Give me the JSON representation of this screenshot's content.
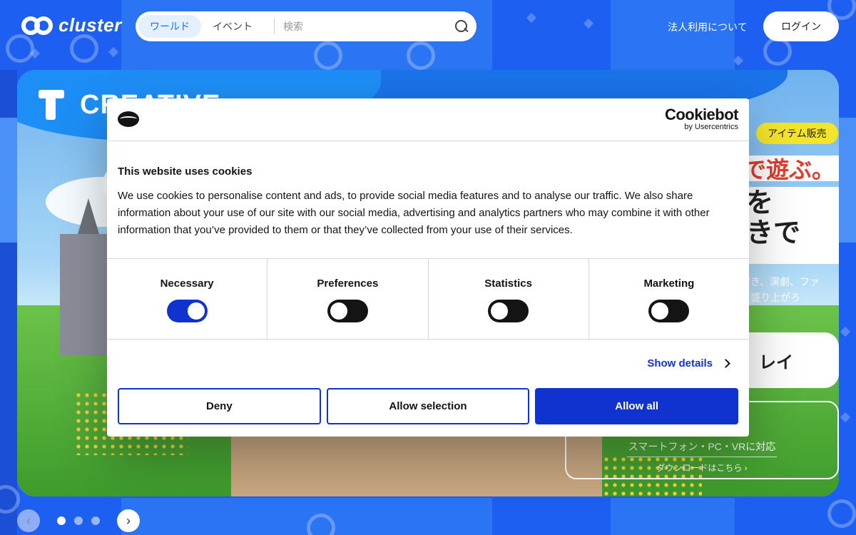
{
  "header": {
    "logo_text": "cluster",
    "tabs": [
      {
        "label": "ワールド",
        "active": true
      },
      {
        "label": "イベント",
        "active": false
      }
    ],
    "search": {
      "placeholder": "検索",
      "value": ""
    },
    "corporate_link": "法人利用について",
    "login_label": "ログイン"
  },
  "hero": {
    "title": "CREATIVE",
    "badge": "アイテム販売",
    "headline_red": "で遊ぶ。",
    "headline_main": "を\nきで",
    "description": "謎解き、演劇、ファ\nなと盛り上がろ",
    "play_card_text": "レイ",
    "download": {
      "platforms": "スマートフォン・PC・VRに対応",
      "link_text": "ダウンロードはこちら ›"
    }
  },
  "carousel": {
    "prev_icon": "chevron-left-icon",
    "next_icon": "chevron-right-icon",
    "dots": 3,
    "active_dot": 0
  },
  "cookie_dialog": {
    "brand_name": "Cookiebot",
    "brand_sub": "by Usercentrics",
    "title": "This website uses cookies",
    "text": "We use cookies to personalise content and ads, to provide social media features and to analyse our traffic. We also share information about your use of our site with our social media, advertising and analytics partners who may combine it with other information that you’ve provided to them or that they’ve collected from your use of their services.",
    "categories": [
      {
        "label": "Necessary",
        "checked": true
      },
      {
        "label": "Preferences",
        "checked": false
      },
      {
        "label": "Statistics",
        "checked": false
      },
      {
        "label": "Marketing",
        "checked": false
      }
    ],
    "show_details_label": "Show details",
    "buttons": {
      "deny": "Deny",
      "allow_selection": "Allow selection",
      "allow_all": "Allow all"
    }
  },
  "colors": {
    "background_blue": "#1d5ff0",
    "cookie_accent": "#1032cf",
    "badge_yellow": "#f5e52a",
    "headline_red": "#e43b2c"
  }
}
